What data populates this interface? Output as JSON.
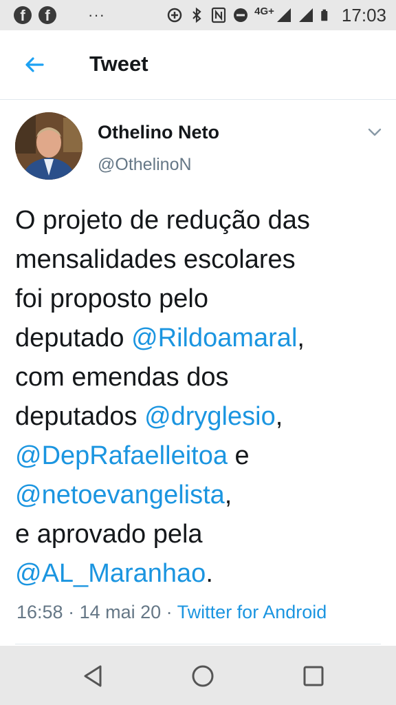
{
  "status_bar": {
    "network": "4G+",
    "time": "17:03"
  },
  "header": {
    "title": "Tweet"
  },
  "tweet": {
    "author_name": "Othelino Neto",
    "author_handle": "@OthelinoN",
    "text_lines": [
      [
        {
          "text": "O projeto de redução das"
        }
      ],
      [
        {
          "text": "mensalidades escolares"
        }
      ],
      [
        {
          "text": "foi proposto pelo"
        }
      ],
      [
        {
          "text": "deputado "
        },
        {
          "text": "@Rildoamaral",
          "mention": true
        },
        {
          "text": ","
        }
      ],
      [
        {
          "text": "com emendas dos"
        }
      ],
      [
        {
          "text": "deputados "
        },
        {
          "text": "@dryglesio",
          "mention": true
        },
        {
          "text": ","
        }
      ],
      [
        {
          "text": "@DepRafaelleitoa",
          "mention": true
        },
        {
          "text": " e"
        }
      ],
      [
        {
          "text": "@netoevangelista",
          "mention": true
        },
        {
          "text": ","
        }
      ],
      [
        {
          "text": "e aprovado pela"
        }
      ],
      [
        {
          "text": "@AL_Maranhao",
          "mention": true
        },
        {
          "text": "."
        }
      ]
    ],
    "time": "16:58",
    "date": "14 mai 20",
    "source": "Twitter for Android",
    "separator": " · "
  },
  "colors": {
    "link": "#1b95e0",
    "secondary_text": "#657786",
    "primary_text": "#14171a"
  }
}
